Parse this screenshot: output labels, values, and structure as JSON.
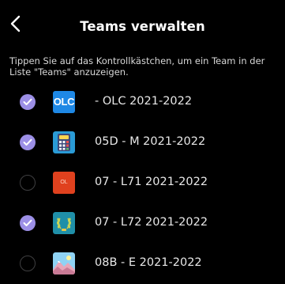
{
  "header": {
    "title": "Teams verwalten"
  },
  "instructions": {
    "line1": "Tippen Sie auf das Kontrollkästchen, um ein Team in der",
    "line2": "Liste \"Teams\" anzuzeigen."
  },
  "teams": [
    {
      "name": "- OLC 2021-2022",
      "checked": true,
      "icon": "olc-logo-icon",
      "icon_text": "OLC"
    },
    {
      "name": "05D - M 2021-2022",
      "checked": true,
      "icon": "calculator-icon"
    },
    {
      "name": "07 - L71 2021-2022",
      "checked": false,
      "icon": "ol-logo-icon",
      "icon_text": "OL"
    },
    {
      "name": "07 - L72 2021-2022",
      "checked": true,
      "icon": "laurel-wreath-icon"
    },
    {
      "name": "08B - E 2021-2022",
      "checked": false,
      "icon": "landscape-icon"
    }
  ],
  "colors": {
    "background": "#000000",
    "checkbox_checked": "#9c8fe6",
    "checkbox_unchecked_border": "#3f3f41",
    "text": "#e8e8e8"
  }
}
